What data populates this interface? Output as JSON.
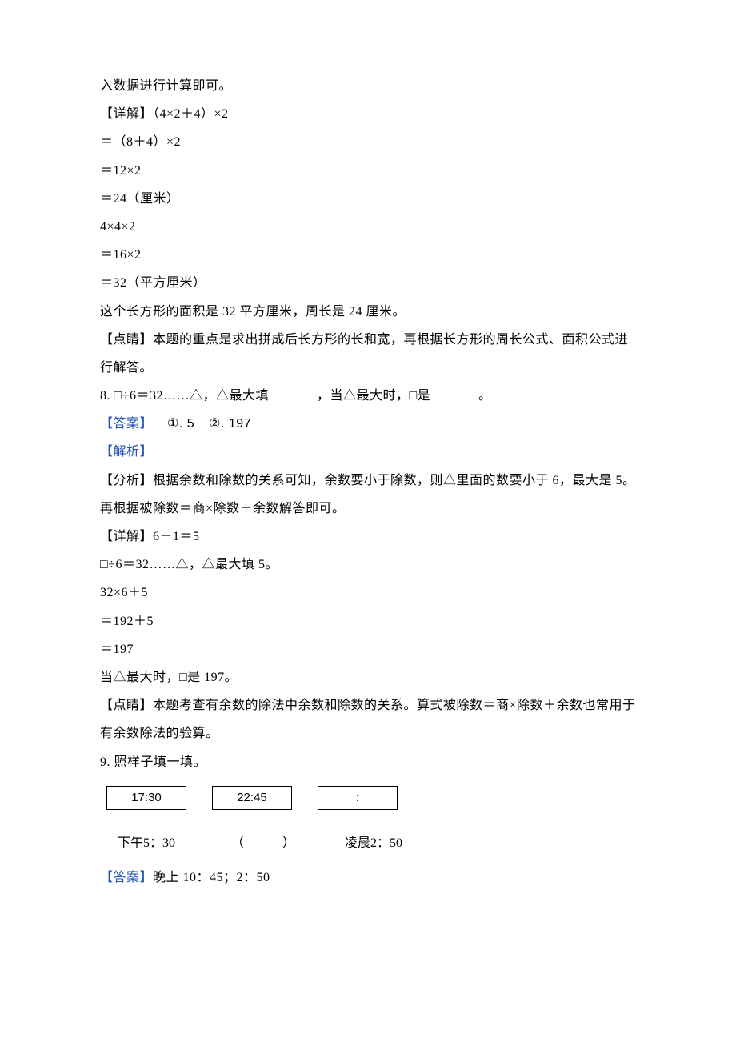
{
  "lines": {
    "l1": "入数据进行计算即可。",
    "l2": "【详解】（4×2＋4）×2",
    "l3": "＝（8＋4）×2",
    "l4": "＝12×2",
    "l5": "＝24（厘米）",
    "l6": "4×4×2",
    "l7": "＝16×2",
    "l8": "＝32（平方厘米）",
    "l9": "这个长方形的面积是 32 平方厘米，周长是 24 厘米。",
    "l10": "【点睛】本题的重点是求出拼成后长方形的长和宽，再根据长方形的周长公式、面积公式进行解答。",
    "q8_prefix": "8. □÷6＝32……△，△最大填",
    "q8_mid": "，当△最大时，□是",
    "q8_suffix": "。",
    "ans8_label": "【答案】",
    "ans8_c1": "①. 5",
    "ans8_c2": "②. 197",
    "analysis_label": "【解析】",
    "a8_1": "【分析】根据余数和除数的关系可知，余数要小于除数，则△里面的数要小于 6，最大是 5。再根据被除数＝商×除数＋余数解答即可。",
    "a8_2": "【详解】6－1＝5",
    "a8_3": "□÷6＝32……△，△最大填 5。",
    "a8_4": "32×6＋5",
    "a8_5": "＝192＋5",
    "a8_6": "＝197",
    "a8_7": "当△最大时，□是 197。",
    "a8_8": "【点睛】本题考查有余数的除法中余数和除数的关系。算式被除数＝商×除数＋余数也常用于有余数除法的验算。",
    "q9": "9. 照样子填一填。",
    "box1": "17:30",
    "box2": "22:45",
    "box3": ":",
    "lbl1": "下午5：30",
    "lbl2": "（　　　）",
    "lbl3": "凌晨2：50",
    "ans9_label": "【答案】",
    "ans9_val": "晚上 10：45；2：50"
  }
}
